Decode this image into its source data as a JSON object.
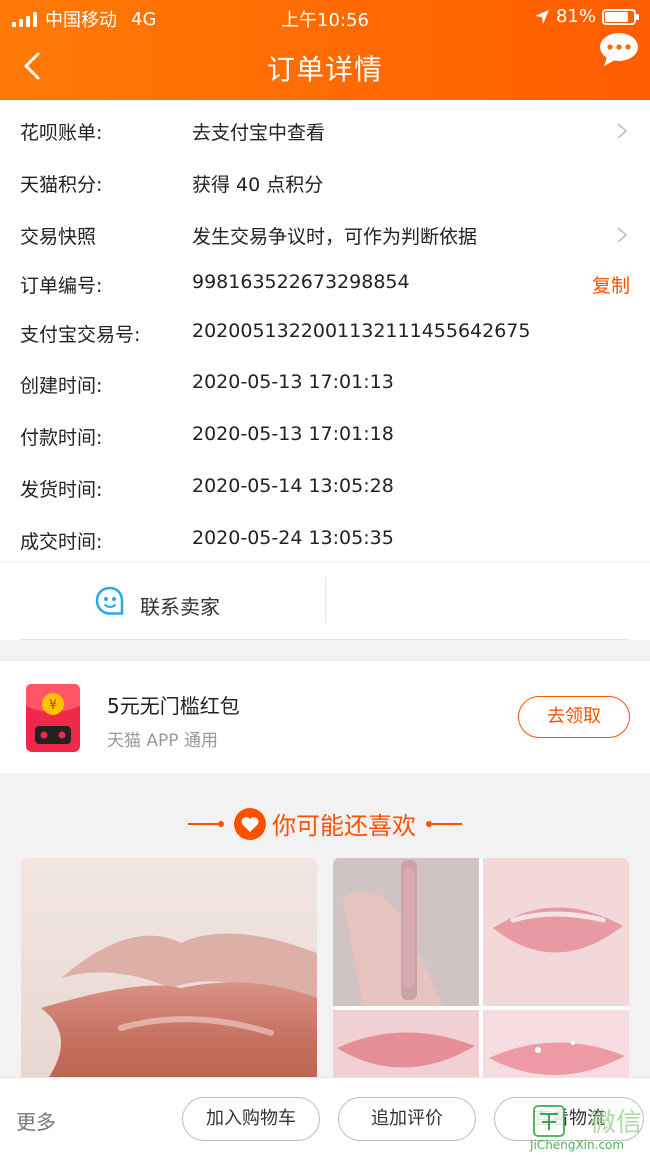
{
  "status_bar": {
    "carrier": "中国移动",
    "network": "4G",
    "time": "上午10:56",
    "battery": "81%",
    "battery_level": 0.81
  },
  "header": {
    "title": "订单详情"
  },
  "order_info": [
    {
      "key": "花呗账单:",
      "value": "去支付宝中查看",
      "chevron": true
    },
    {
      "key": "天猫积分:",
      "value": "获得 40 点积分"
    },
    {
      "key": "交易快照",
      "value": "发生交易争议时，可作为判断依据",
      "chevron": true
    },
    {
      "key": "订单编号:",
      "value": "998163522673298854",
      "action": "复制"
    },
    {
      "key": "支付宝交易号:",
      "value": "2020051322001132111455642675"
    },
    {
      "key": "创建时间:",
      "value": "2020-05-13 17:01:13"
    },
    {
      "key": "付款时间:",
      "value": "2020-05-13 17:01:18"
    },
    {
      "key": "发货时间:",
      "value": "2020-05-14 13:05:28"
    },
    {
      "key": "成交时间:",
      "value": "2020-05-24 13:05:35"
    }
  ],
  "contact": {
    "label": "联系卖家"
  },
  "red_packet": {
    "title": "5元无门槛红包",
    "subtitle": "天猫 APP 通用",
    "button": "去领取"
  },
  "recommend": {
    "title": "你可能还喜欢",
    "items": [
      {
        "image": "lips-photo"
      },
      {
        "image": "lipgloss-collage"
      }
    ]
  },
  "bottom_bar": {
    "more": "更多",
    "buttons": [
      "加入购物车",
      "追加评价",
      "查看物流"
    ]
  },
  "watermark": {
    "text": "微信",
    "url": "JiChengXin.com"
  },
  "colors": {
    "accent": "#ff5000",
    "header_start": "#ff7a06",
    "header_end": "#ff5d00",
    "contact_icon": "#2aa7ee"
  }
}
